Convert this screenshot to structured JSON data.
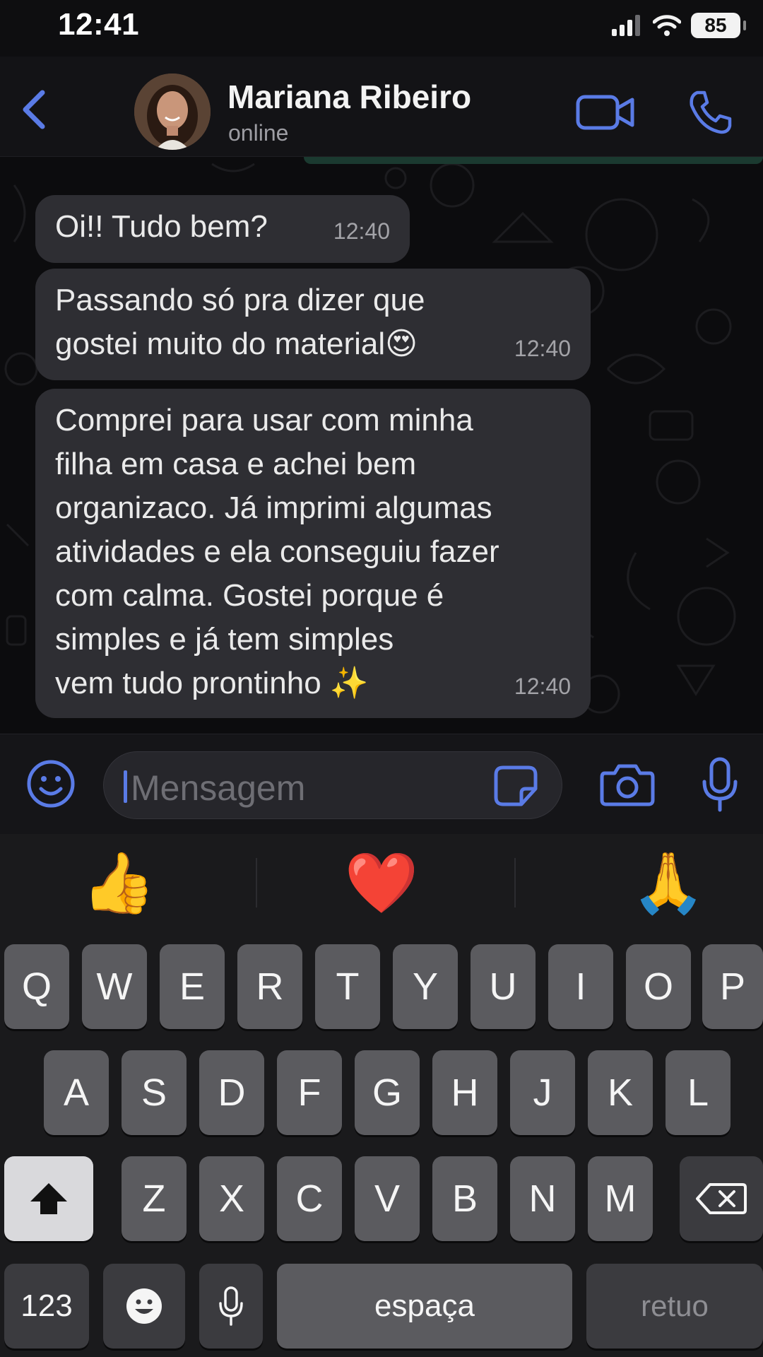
{
  "status_bar": {
    "time": "12:41",
    "battery": "85"
  },
  "header": {
    "contact_name": "Mariana Ribeiro",
    "contact_status": "online"
  },
  "messages": [
    {
      "text": "Oi!! Tudo bem?",
      "time": "12:40"
    },
    {
      "text": "Passando só pra dizer que\ngostei muito do material😍",
      "time": "12:40"
    },
    {
      "text": "Comprei para usar com minha\nfilha em casa e achei bem\norganizaco. Já imprimi algumas\natividades e ela conseguiu fazer\ncom calma. Gostei porque é\nsimples e já tem simples\nvem tudo prontinho ✨",
      "time": "12:40"
    }
  ],
  "composer": {
    "placeholder": "Mensagem"
  },
  "keyboard": {
    "emoji_suggestions": [
      "👍",
      "❤️",
      "🙏"
    ],
    "row1": [
      "Q",
      "W",
      "E",
      "R",
      "T",
      "Y",
      "U",
      "I",
      "O",
      "P"
    ],
    "row2": [
      "A",
      "S",
      "D",
      "F",
      "G",
      "H",
      "J",
      "K",
      "L"
    ],
    "row3": [
      "Z",
      "X",
      "C",
      "V",
      "B",
      "N",
      "M"
    ],
    "numbers_label": "123",
    "space_label": "espaça",
    "return_label": "retuo"
  },
  "colors": {
    "accent_blue": "#5a7be6",
    "bubble": "#2e2e33",
    "keyboard_bg": "#1a1a1c",
    "key": "#5b5b5f"
  }
}
